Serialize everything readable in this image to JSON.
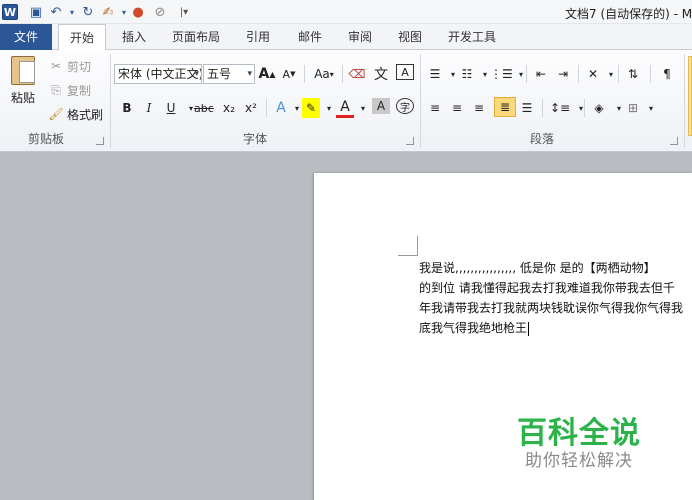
{
  "window": {
    "title": "文档7 (自动保存的) - M"
  },
  "tabs": [
    "文件",
    "开始",
    "插入",
    "页面布局",
    "引用",
    "邮件",
    "审阅",
    "视图",
    "开发工具"
  ],
  "clipboard": {
    "paste": "粘贴",
    "cut": "剪切",
    "copy": "复制",
    "format_painter": "格式刷",
    "group": "剪贴板"
  },
  "font": {
    "name": "宋体 (中文正文)",
    "size": "五号",
    "group": "字体",
    "bold": "B",
    "italic": "I",
    "underline": "U",
    "strike": "abc",
    "subscript": "x₂",
    "superscript": "x²",
    "case": "Aa",
    "grow": "A",
    "shrink": "A",
    "font_color": "A",
    "char_shading": "A",
    "wen": "文",
    "zi": "字"
  },
  "paragraph": {
    "group": "段落"
  },
  "document": {
    "lines": [
      "我是说,,,,,,,,,,,,,,,, 低是你  是的【两栖动物】",
      "的到位  请我懂得起我去打我难道我你带我去但千",
      "年我请带我去打我就两块钱耽误你气得我你气得我",
      "底我气得我绝地枪王"
    ]
  },
  "watermark": {
    "title": "百科全说",
    "subtitle": "助你轻松解决"
  },
  "colors": {
    "file_tab": "#2b5797",
    "accent_green": "#2bb34a",
    "selected_button": "#fbd97a"
  }
}
